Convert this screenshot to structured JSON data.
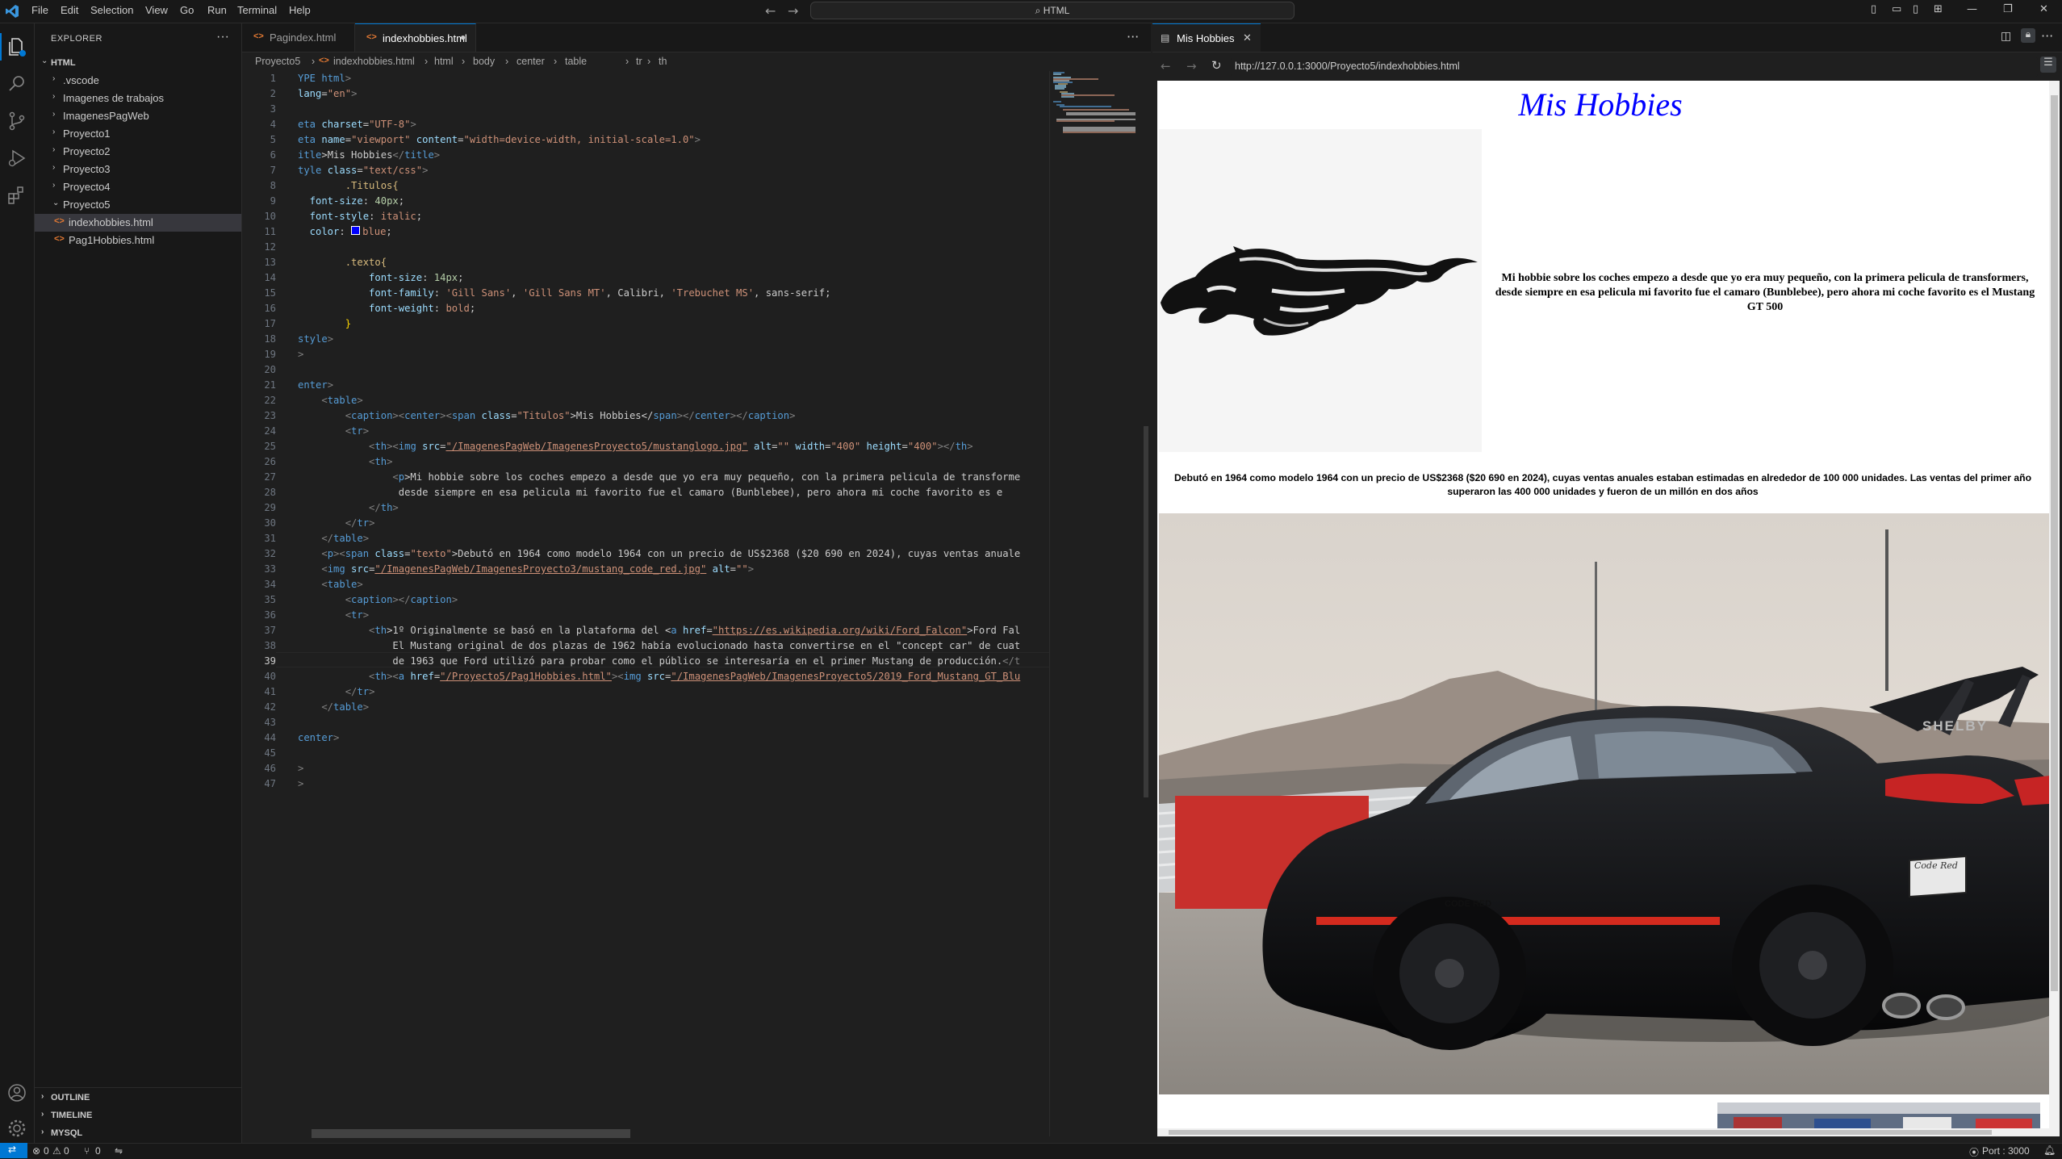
{
  "titlebar": {
    "menu": [
      "File",
      "Edit",
      "Selection",
      "View",
      "Go",
      "Run",
      "Terminal",
      "Help"
    ],
    "search_text": "HTML"
  },
  "sidebar": {
    "header": "EXPLORER",
    "root": "HTML",
    "items": [
      {
        "label": ".vscode",
        "type": "folder"
      },
      {
        "label": "Imagenes de trabajos",
        "type": "folder"
      },
      {
        "label": "ImagenesPagWeb",
        "type": "folder"
      },
      {
        "label": "Proyecto1",
        "type": "folder"
      },
      {
        "label": "Proyecto2",
        "type": "folder"
      },
      {
        "label": "Proyecto3",
        "type": "folder"
      },
      {
        "label": "Proyecto4",
        "type": "folder"
      },
      {
        "label": "Proyecto5",
        "type": "folder-open"
      },
      {
        "label": "indexhobbies.html",
        "type": "file"
      },
      {
        "label": "Pag1Hobbies.html",
        "type": "file"
      }
    ],
    "sections": [
      "OUTLINE",
      "TIMELINE",
      "MYSQL"
    ]
  },
  "editor": {
    "tabs": [
      "Pagindex.html",
      "indexhobbies.html"
    ],
    "breadcrumb": [
      "Proyecto5",
      "indexhobbies.html",
      "html",
      "body",
      "center",
      "table",
      "tr",
      "th"
    ],
    "current_line": 39,
    "line_numbers": [
      "1",
      "2",
      "3",
      "4",
      "5",
      "6",
      "7",
      "8",
      "9",
      "10",
      "11",
      "12",
      "13",
      "14",
      "15",
      "16",
      "17",
      "18",
      "19",
      "20",
      "21",
      "22",
      "23",
      "24",
      "25",
      "26",
      "27",
      "28",
      "29",
      "30",
      "31",
      "32",
      "33",
      "34",
      "35",
      "36",
      "37",
      "38",
      "39",
      "40",
      "41",
      "42",
      "43",
      "44",
      "45",
      "46",
      "47"
    ],
    "lines": {
      "l1a": "YPE ",
      "l1b": "html",
      "l1c": ">",
      "l2a": "lang",
      "l2b": "=",
      "l2c": "\"en\"",
      "l2d": ">",
      "l4a": "eta ",
      "l4b": "charset",
      "l4c": "=",
      "l4d": "\"UTF-8\"",
      "l4e": ">",
      "l5a": "eta ",
      "l5b": "name",
      "l5c": "=",
      "l5d": "\"viewport\"",
      "l5e": " content",
      "l5f": "=",
      "l5g": "\"width=device-width, initial-scale=1.0\"",
      "l5h": ">",
      "l6a": "itle",
      "l6b": ">Mis Hobbies",
      "l6c": "</",
      "l6d": "title",
      "l6e": ">",
      "l7a": "tyle ",
      "l7b": "class",
      "l7c": "=",
      "l7d": "\"text/css\"",
      "l7e": ">",
      "l8": "        .Titulos{",
      "l9a": "  font-size",
      "l9b": ": ",
      "l9c": "40px",
      "l9d": ";",
      "l10a": "  font-style",
      "l10b": ": ",
      "l10c": "italic",
      "l10d": ";",
      "l11a": "  color",
      "l11b": ": ",
      "l11c": "blue",
      "l11d": ";",
      "l13": "        .texto{",
      "l14a": "            font-size",
      "l14b": ": ",
      "l14c": "14px",
      "l14d": ";",
      "l15a": "            font-family",
      "l15b": ": ",
      "l15c": "'Gill Sans'",
      "l15d": ", ",
      "l15e": "'Gill Sans MT'",
      "l15f": ", Calibri, ",
      "l15g": "'Trebuchet MS'",
      "l15h": ", sans-serif;",
      "l16a": "            font-weight",
      "l16b": ": ",
      "l16c": "bold",
      "l16d": ";",
      "l17": "        }",
      "l18a": "style",
      "l18b": ">",
      "l19": ">",
      "l21a": "enter",
      "l21b": ">",
      "l22a": "    <",
      "l22b": "table",
      "l22c": ">",
      "l23a": "        <",
      "l23b": "caption",
      "l23c": "><",
      "l23d": "center",
      "l23e": "><",
      "l23f": "span ",
      "l23g": "class",
      "l23h": "=",
      "l23i": "\"Titulos\"",
      "l23j": ">Mis Hobbies</",
      "l23k": "span",
      "l23l": "></",
      "l23m": "center",
      "l23n": "></",
      "l23o": "caption",
      "l23p": ">",
      "l24a": "        <",
      "l24b": "tr",
      "l24c": ">",
      "l25a": "            <",
      "l25b": "th",
      "l25c": "><",
      "l25d": "img ",
      "l25e": "src",
      "l25f": "=",
      "l25g": "\"/ImagenesPagWeb/ImagenesProyecto5/mustanglogo.jpg\"",
      "l25h": " alt",
      "l25i": "=",
      "l25j": "\"\"",
      "l25k": " width",
      "l25l": "=",
      "l25m": "\"400\"",
      "l25n": " height",
      "l25o": "=",
      "l25p": "\"400\"",
      "l25q": "></",
      "l25r": "th",
      "l25s": ">",
      "l26a": "            <",
      "l26b": "th",
      "l26c": ">",
      "l27a": "                <",
      "l27b": "p",
      "l27c": ">Mi hobbie sobre los coches empezo a desde que yo era muy pequeño, con la primera pelicula de transforme",
      "l28": "                 desde siempre en esa pelicula mi favorito fue el camaro (Bunblebee), pero ahora mi coche favorito es e",
      "l29a": "            </",
      "l29b": "th",
      "l29c": ">",
      "l30a": "        </",
      "l30b": "tr",
      "l30c": ">",
      "l31a": "    </",
      "l31b": "table",
      "l31c": ">",
      "l32a": "    <",
      "l32b": "p",
      "l32c": "><",
      "l32d": "span ",
      "l32e": "class",
      "l32f": "=",
      "l32g": "\"texto\"",
      "l32h": ">Debutó en 1964 como modelo 1964 con un precio de US$2368 ($20 690 en 2024), cuyas ventas anuale",
      "l33a": "    <",
      "l33b": "img ",
      "l33c": "src",
      "l33d": "=",
      "l33e": "\"/ImagenesPagWeb/ImagenesProyecto3/mustang_code_red.jpg\"",
      "l33f": " alt",
      "l33g": "=",
      "l33h": "\"\"",
      "l33i": ">",
      "l34a": "    <",
      "l34b": "table",
      "l34c": ">",
      "l35a": "        <",
      "l35b": "caption",
      "l35c": "></",
      "l35d": "caption",
      "l35e": ">",
      "l36a": "        <",
      "l36b": "tr",
      "l36c": ">",
      "l37a": "            <",
      "l37b": "th",
      "l37c": ">1º Originalmente se basó en la plataforma del <",
      "l37d": "a ",
      "l37e": "href",
      "l37f": "=",
      "l37g": "\"https://es.wikipedia.org/wiki/Ford_Falcon\"",
      "l37h": ">Ford Fal",
      "l38": "                El Mustang original de dos plazas de 1962 había evolucionado hasta convertirse en el \"concept car\" de cuat",
      "l39a": "                de 1963 que Ford utilizó para probar como el público se interesaría en el primer Mustang de producción.",
      "l39b": "</t",
      "l40a": "            <",
      "l40b": "th",
      "l40c": "><",
      "l40d": "a ",
      "l40e": "href",
      "l40f": "=",
      "l40g": "\"/Proyecto5/Pag1Hobbies.html\"",
      "l40h": "><",
      "l40i": "img ",
      "l40j": "src",
      "l40k": "=",
      "l40l": "\"/ImagenesPagWeb/ImagenesProyecto5/2019_Ford_Mustang_GT_Blu",
      "l41a": "        </",
      "l41b": "tr",
      "l41c": ">",
      "l42a": "    </",
      "l42b": "table",
      "l42c": ">",
      "l44a": "center",
      "l44b": ">",
      "l46": ">",
      "l47": ">"
    }
  },
  "preview": {
    "tab_title": "Mis Hobbies",
    "url": "http://127.0.0.1:3000/Proyecto5/indexhobbies.html",
    "page": {
      "title": "Mis Hobbies",
      "intro": "Mi hobbie sobre los coches empezo a desde que yo era muy pequeño, con la primera pelicula de transformers, desde siempre en esa pelicula mi favorito fue el camaro (Bunblebee), pero ahora mi coche favorito es el Mustang GT 500",
      "texto": "Debutó en 1964 como modelo 1964 con un precio de US$2368 ($20 690 en 2024), cuyas ventas anuales estaban estimadas en alrededor de 100 000 unidades. Las ventas del primer año superaron las 400 000 unidades y fueron de un millón en dos años",
      "car_plate": "Code Red",
      "car_badge": "SHELBY",
      "car_side": "CODE RED"
    }
  },
  "statusbar": {
    "errors": "0",
    "warnings": "0",
    "ports": "0",
    "port_label": "Port : 3000"
  },
  "colors": {
    "accent": "#0078d4",
    "title_blue": "#0000ff",
    "editor_bg": "#1f1f1f",
    "chrome_bg": "#181818"
  }
}
